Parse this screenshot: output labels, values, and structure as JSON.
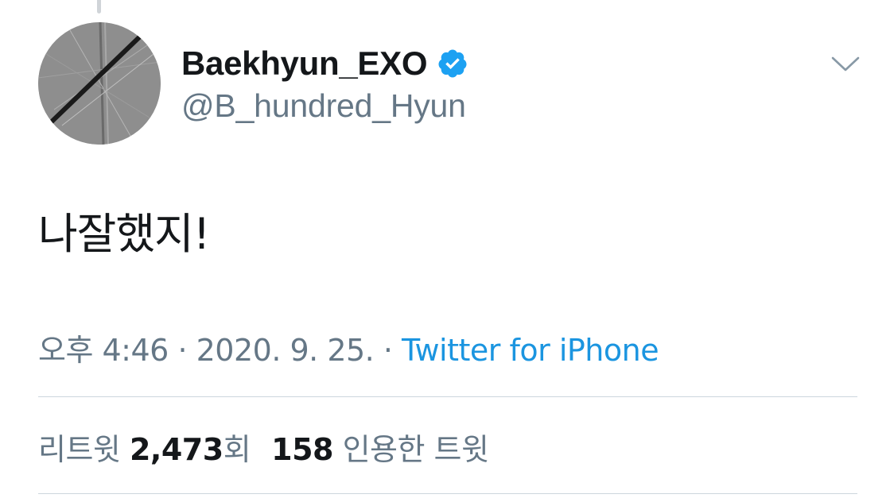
{
  "user": {
    "display_name": "Baekhyun_EXO",
    "handle": "@B_hundred_Hyun",
    "verified_icon": "verified-badge-icon",
    "avatar_icon": "avatar-image"
  },
  "tweet": {
    "text": "나잘했지!"
  },
  "meta": {
    "time": "오후 4:46",
    "separator": "·",
    "date": "2020. 9. 25.",
    "source": "Twitter for iPhone"
  },
  "stats": {
    "retweets_label": "리트윗",
    "retweets_count": "2,473",
    "retweets_suffix": "회",
    "quotes_count": "158",
    "quotes_label": "인용한 트윗"
  },
  "menu": {
    "icon": "chevron-down-icon"
  },
  "colors": {
    "text_primary": "#14171a",
    "text_secondary": "#657786",
    "link": "#1b95e0",
    "verified": "#1da1f2",
    "divider": "#ccd6dd"
  }
}
